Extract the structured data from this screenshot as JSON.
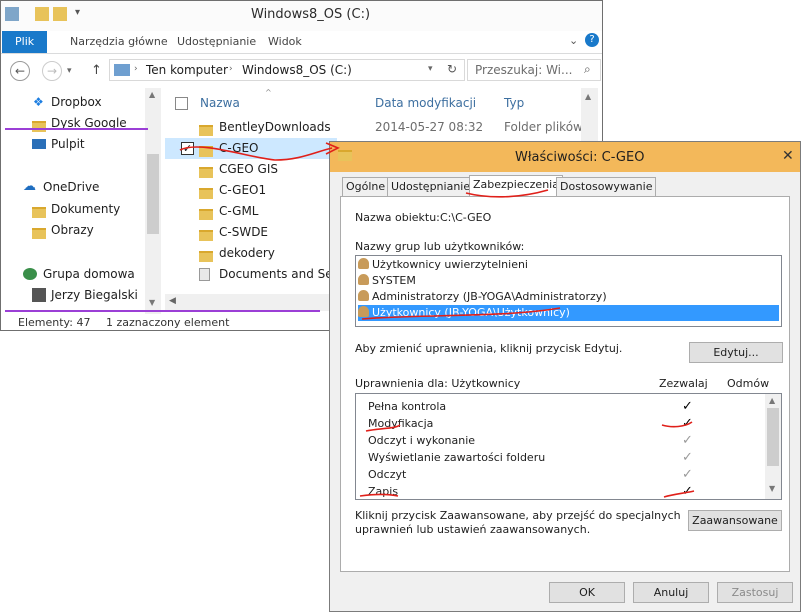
{
  "explorer": {
    "title": "Windows8_OS (C:)",
    "ribbon_tabs": [
      "Plik",
      "Narzędzia główne",
      "Udostępnianie",
      "Widok"
    ],
    "breadcrumb": [
      "Ten komputer",
      "Windows8_OS (C:)"
    ],
    "search_placeholder": "Przeszukaj: Wi...",
    "nav_items": {
      "dropbox": "Dropbox",
      "google": "Dysk Google",
      "desktop": "Pulpit",
      "onedrive": "OneDrive",
      "documents": "Dokumenty",
      "images": "Obrazy",
      "homegroup": "Grupa domowa",
      "user": "Jerzy Biegalski"
    },
    "columns": {
      "name": "Nazwa",
      "date": "Data modyfikacji",
      "type": "Typ"
    },
    "files": [
      {
        "name": "BentleyDownloads",
        "date": "2014-05-27 08:32",
        "type": "Folder plików"
      },
      {
        "name": "C-GEO",
        "date": "",
        "type": ""
      },
      {
        "name": "CGEO GIS",
        "date": "",
        "type": ""
      },
      {
        "name": "C-GEO1",
        "date": "",
        "type": ""
      },
      {
        "name": "C-GML",
        "date": "",
        "type": ""
      },
      {
        "name": "C-SWDE",
        "date": "",
        "type": ""
      },
      {
        "name": "dekodery",
        "date": "",
        "type": ""
      },
      {
        "name": "Documents and Setti",
        "date": "",
        "type": ""
      }
    ],
    "status": {
      "count": "Elementy: 47",
      "selected": "1 zaznaczony element"
    }
  },
  "dialog": {
    "title": "Właściwości: C-GEO",
    "tabs": [
      "Ogólne",
      "Udostępnianie",
      "Zabezpieczenia",
      "Dostosowywanie"
    ],
    "object_label": "Nazwa obiektu:",
    "object_value": "C:\\C-GEO",
    "groups_label": "Nazwy grup lub użytkowników:",
    "users": [
      "Użytkownicy uwierzytelnieni",
      "SYSTEM",
      "Administratorzy (JB-YOGA\\Administratorzy)",
      "Użytkownicy (JB-YOGA\\Użytkownicy)"
    ],
    "edit_hint": "Aby zmienić uprawnienia, kliknij przycisk Edytuj.",
    "edit_button": "Edytuj...",
    "perm_label": "Uprawnienia dla: Użytkownicy",
    "allow_label": "Zezwalaj",
    "deny_label": "Odmów",
    "permissions": [
      {
        "name": "Pełna kontrola",
        "check": "✓"
      },
      {
        "name": "Modyfikacja",
        "check": "✓"
      },
      {
        "name": "Odczyt i wykonanie",
        "check": "✓"
      },
      {
        "name": "Wyświetlanie zawartości folderu",
        "check": "✓"
      },
      {
        "name": "Odczyt",
        "check": "✓"
      },
      {
        "name": "Zapis",
        "check": "✓"
      }
    ],
    "advanced_hint_1": "Kliknij przycisk Zaawansowane, aby przejść do specjalnych",
    "advanced_hint_2": "uprawnień lub ustawień zaawansowanych.",
    "advanced_button": "Zaawansowane",
    "ok_button": "OK",
    "cancel_button": "Anuluj",
    "apply_button": "Zastosuj"
  },
  "colors": {
    "ribbon_file": "#1979ca",
    "selection": "#3399ff",
    "dialog_title": "#f3b85a",
    "annotation": "#e0201a"
  }
}
